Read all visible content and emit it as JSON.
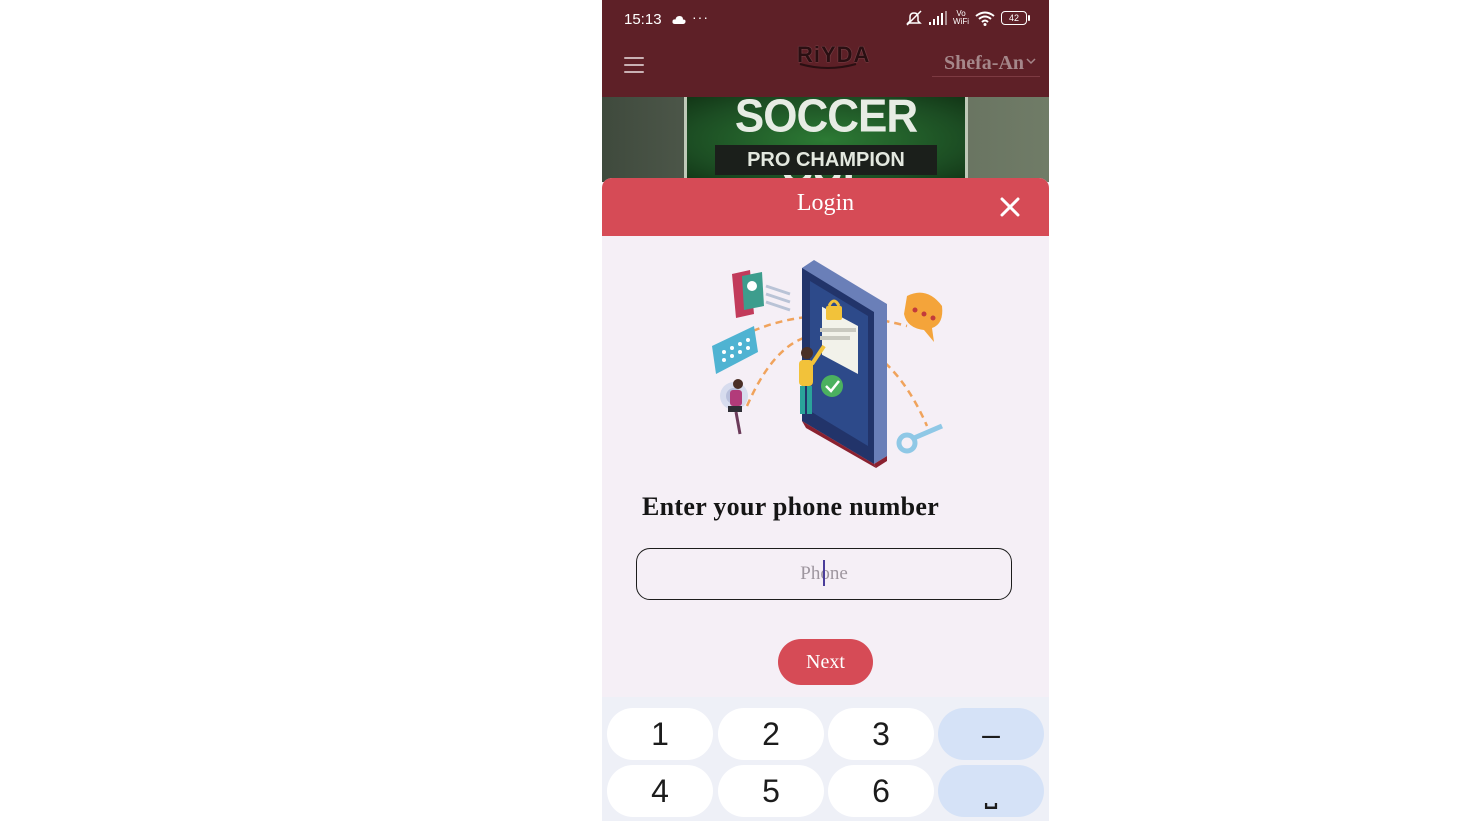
{
  "status_bar": {
    "time": "15:13",
    "dots": "···",
    "volte_top": "Vo",
    "volte_bottom": "WiFi",
    "battery": "42",
    "icons": [
      "cloud-icon",
      "mute-icon",
      "signal-icon",
      "wifi-icon",
      "battery-icon"
    ]
  },
  "header": {
    "brand": "RiYDA",
    "language": "Shefa-An"
  },
  "banner": {
    "title": "SOCCER CUP",
    "subtitle": "PRO CHAMPION LEAGUE"
  },
  "login": {
    "title": "Login",
    "prompt": "Enter your phone number",
    "phone_placeholder": "Phone",
    "phone_value": "",
    "next_label": "Next"
  },
  "keyboard": {
    "row1": [
      "1",
      "2",
      "3",
      "–"
    ],
    "row2": [
      "4",
      "5",
      "6",
      "⎵"
    ]
  },
  "colors": {
    "header_bg": "#5e2027",
    "accent": "#d64b56",
    "modal_bg": "#f5eff6",
    "keyboard_bg": "#eef0f7",
    "fn_key_bg": "#d5e2f7"
  }
}
